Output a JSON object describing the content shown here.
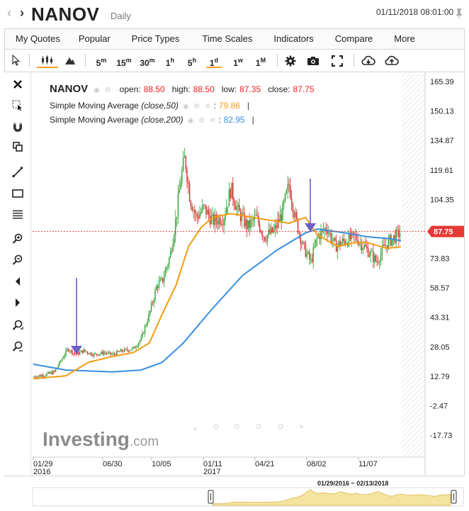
{
  "header": {
    "symbol": "NANOV",
    "period": "Daily",
    "timestamp": "01/11/2018 08:01:00"
  },
  "menu": [
    "My Quotes",
    "Popular",
    "Price Types",
    "Time Scales",
    "Indicators",
    "Compare",
    "More"
  ],
  "toolbar": {
    "timeframes": [
      {
        "base": "5",
        "sup": "m"
      },
      {
        "base": "15",
        "sup": "m"
      },
      {
        "base": "30",
        "sup": "m"
      },
      {
        "base": "1",
        "sup": "h"
      },
      {
        "base": "5",
        "sup": "h"
      },
      {
        "base": "1",
        "sup": "d"
      },
      {
        "base": "1",
        "sup": "w"
      },
      {
        "base": "1",
        "sup": "M"
      }
    ],
    "selected_timeframe": "1d"
  },
  "legend": {
    "symbol": "NANOV",
    "open_label": "open:",
    "open": "88.50",
    "high_label": "high:",
    "high": "88.50",
    "low_label": "low:",
    "low": "87.35",
    "close_label": "close:",
    "close": "87.75",
    "sma50_name": "Simple Moving Average",
    "sma50_params": "(close,50)",
    "sma50_value": "79.86",
    "sma200_name": "Simple Moving Average",
    "sma200_params": "(close,200)",
    "sma200_value": "82.95"
  },
  "chart_data": {
    "type": "candlestick",
    "y_ticks": [
      "165.39",
      "150.13",
      "134.87",
      "119.61",
      "104.35",
      "89.09",
      "73.83",
      "58.57",
      "43.31",
      "28.05",
      "12.79",
      "-2.47",
      "-17.73"
    ],
    "ylim": [
      -17.73,
      165.39
    ],
    "x_ticks": [
      {
        "label": "01/29",
        "sub": "2016"
      },
      {
        "label": "06/30",
        "sub": ""
      },
      {
        "label": "10/05",
        "sub": ""
      },
      {
        "label": "01/11",
        "sub": "2017"
      },
      {
        "label": "04/21",
        "sub": ""
      },
      {
        "label": "08/02",
        "sub": ""
      },
      {
        "label": "11/07",
        "sub": ""
      }
    ],
    "last_price": "87.75",
    "close_series": [
      {
        "x": "01/29/2016",
        "y": 12.5
      },
      {
        "x": "02/20/2016",
        "y": 13.5
      },
      {
        "x": "03/10/2016",
        "y": 15
      },
      {
        "x": "03/25/2016",
        "y": 22
      },
      {
        "x": "04/05/2016",
        "y": 27
      },
      {
        "x": "04/20/2016",
        "y": 24
      },
      {
        "x": "05/05/2016",
        "y": 26
      },
      {
        "x": "05/25/2016",
        "y": 24
      },
      {
        "x": "06/15/2016",
        "y": 25
      },
      {
        "x": "06/30/2016",
        "y": 24
      },
      {
        "x": "07/20/2016",
        "y": 26
      },
      {
        "x": "08/10/2016",
        "y": 27
      },
      {
        "x": "08/25/2016",
        "y": 32
      },
      {
        "x": "09/10/2016",
        "y": 45
      },
      {
        "x": "09/25/2016",
        "y": 60
      },
      {
        "x": "10/05/2016",
        "y": 62
      },
      {
        "x": "10/20/2016",
        "y": 75
      },
      {
        "x": "11/01/2016",
        "y": 95
      },
      {
        "x": "11/10/2016",
        "y": 115
      },
      {
        "x": "11/18/2016",
        "y": 126
      },
      {
        "x": "11/28/2016",
        "y": 105
      },
      {
        "x": "12/10/2016",
        "y": 95
      },
      {
        "x": "12/25/2016",
        "y": 100
      },
      {
        "x": "01/11/2017",
        "y": 93
      },
      {
        "x": "02/01/2017",
        "y": 95
      },
      {
        "x": "02/15/2017",
        "y": 110
      },
      {
        "x": "03/01/2017",
        "y": 98
      },
      {
        "x": "03/20/2017",
        "y": 90
      },
      {
        "x": "04/05/2017",
        "y": 95
      },
      {
        "x": "04/21/2017",
        "y": 85
      },
      {
        "x": "05/10/2017",
        "y": 88
      },
      {
        "x": "05/25/2017",
        "y": 97
      },
      {
        "x": "06/08/2017",
        "y": 112
      },
      {
        "x": "06/20/2017",
        "y": 95
      },
      {
        "x": "07/05/2017",
        "y": 80
      },
      {
        "x": "07/20/2017",
        "y": 72
      },
      {
        "x": "08/02/2017",
        "y": 85
      },
      {
        "x": "08/20/2017",
        "y": 90
      },
      {
        "x": "09/05/2017",
        "y": 80
      },
      {
        "x": "09/25/2017",
        "y": 83
      },
      {
        "x": "10/15/2017",
        "y": 85
      },
      {
        "x": "11/07/2017",
        "y": 78
      },
      {
        "x": "11/25/2017",
        "y": 72
      },
      {
        "x": "12/10/2017",
        "y": 80
      },
      {
        "x": "12/25/2017",
        "y": 84
      },
      {
        "x": "01/05/2018",
        "y": 86
      },
      {
        "x": "01/11/2018",
        "y": 87.75
      }
    ],
    "sma50": [
      {
        "x": "01/29/2016",
        "y": 11.5
      },
      {
        "x": "04/01/2016",
        "y": 13
      },
      {
        "x": "05/15/2016",
        "y": 20
      },
      {
        "x": "06/30/2016",
        "y": 23
      },
      {
        "x": "08/10/2016",
        "y": 25
      },
      {
        "x": "09/10/2016",
        "y": 30
      },
      {
        "x": "10/05/2016",
        "y": 45
      },
      {
        "x": "11/01/2016",
        "y": 60
      },
      {
        "x": "11/25/2016",
        "y": 80
      },
      {
        "x": "12/20/2016",
        "y": 90
      },
      {
        "x": "01/11/2017",
        "y": 95
      },
      {
        "x": "02/15/2017",
        "y": 97
      },
      {
        "x": "04/21/2017",
        "y": 94
      },
      {
        "x": "06/08/2017",
        "y": 92
      },
      {
        "x": "07/10/2017",
        "y": 95
      },
      {
        "x": "08/02/2017",
        "y": 86
      },
      {
        "x": "09/10/2017",
        "y": 80
      },
      {
        "x": "10/15/2017",
        "y": 82
      },
      {
        "x": "11/07/2017",
        "y": 82
      },
      {
        "x": "12/15/2017",
        "y": 79
      },
      {
        "x": "01/11/2018",
        "y": 79.86
      }
    ],
    "sma200": [
      {
        "x": "01/29/2016",
        "y": 19
      },
      {
        "x": "04/01/2016",
        "y": 16
      },
      {
        "x": "06/30/2016",
        "y": 15
      },
      {
        "x": "08/25/2016",
        "y": 16
      },
      {
        "x": "10/05/2016",
        "y": 20
      },
      {
        "x": "11/15/2016",
        "y": 30
      },
      {
        "x": "01/11/2017",
        "y": 48
      },
      {
        "x": "03/10/2017",
        "y": 65
      },
      {
        "x": "05/15/2017",
        "y": 78
      },
      {
        "x": "07/10/2017",
        "y": 87
      },
      {
        "x": "08/02/2017",
        "y": 89
      },
      {
        "x": "09/25/2017",
        "y": 87
      },
      {
        "x": "11/07/2017",
        "y": 85
      },
      {
        "x": "12/20/2017",
        "y": 84
      },
      {
        "x": "01/11/2018",
        "y": 82.95
      }
    ],
    "colors": {
      "up": "#2ca02c",
      "down": "#d62728",
      "sma50": "#f39c12",
      "sma200": "#3a8fe0",
      "price_tag": "#e53935",
      "arrow": "#6c5fc7"
    }
  },
  "navigator": {
    "range_text": "01/29/2016 ~ 02/13/2018"
  },
  "watermark": {
    "brand": "Investing",
    "suffix": ".com"
  }
}
